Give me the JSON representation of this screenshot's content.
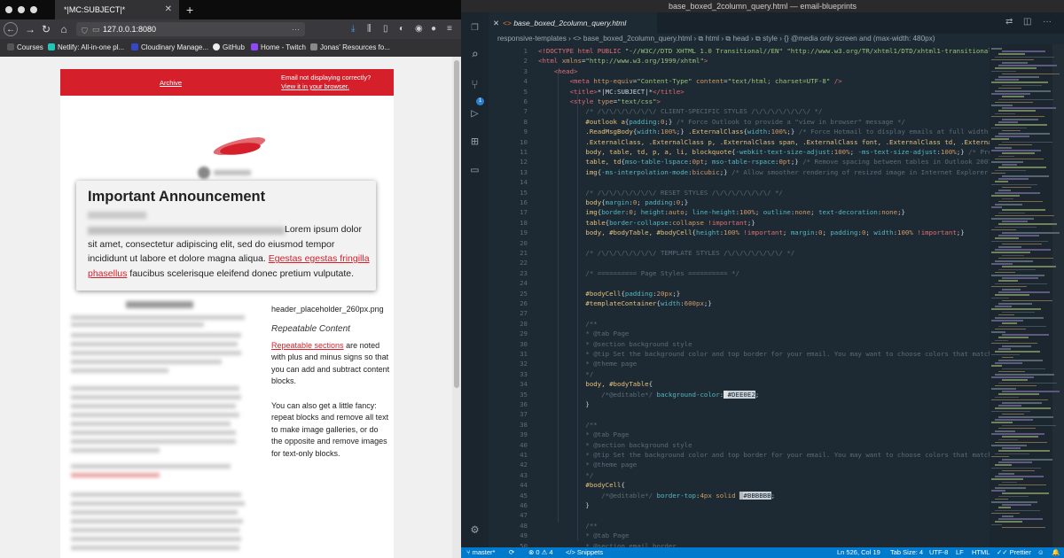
{
  "browser": {
    "tab_title": "*|MC:SUBJECT|*",
    "url": "127.0.0.1:8080",
    "bookmarks": [
      "Courses",
      "Netlify: All-in-one pl...",
      "Cloudinary Manage...",
      "GitHub",
      "Home - Twitch",
      "Jonas' Resources fo..."
    ],
    "email": {
      "archive": "Archive",
      "not_displaying": "Email not displaying correctly?",
      "view_in_browser": "View it in your browser.",
      "announcement_title": "Important Announcement",
      "announcement_text": "Lorem ipsum dolor sit amet, consectetur adipiscing elit, sed do eiusmod tempor incididunt ut labore et dolore magna aliqua.",
      "announcement_link": "Egestas egestas fringilla phasellus",
      "announcement_tail": "faucibus scelerisque eleifend donec pretium vulputate.",
      "column_title": "Number Article",
      "image_placeholder": "header_placeholder_260px.png",
      "repeatable_title": "Repeatable Content",
      "repeatable_link": "Repeatable sections",
      "repeatable_text1": "are noted with plus and minus signs so that you can add and subtract content blocks.",
      "repeatable_text2": "You can also get a little fancy: repeat blocks and remove all text to make image galleries, or do the opposite and remove images for text-only blocks."
    }
  },
  "editor": {
    "window_title": "base_boxed_2column_query.html — email-blueprints",
    "tab_label": "base_boxed_2column_query.html",
    "breadcrumbs": "responsive-templates  ›  <> base_boxed_2column_query.html  ›  ⧉ html  ›  ⧉ head  ›  ⧉ style  ›  {} @media only screen and (max-width: 480px)",
    "scm_badge": "1",
    "lines": [
      {
        "n": "1",
        "html": "<span class='k'>&lt;!DOCTYPE html PUBLIC </span><span class='s'>\"-//W3C//DTD XHTML 1.0 Transitional//EN\" \"http://www.w3.org/TR/xhtml1/DTD/xhtml1-transitional.</span>"
      },
      {
        "n": "2",
        "html": "<span class='k'>&lt;html</span> <span class='a'>xmlns</span>=<span class='s'>\"http://www.w3.org/1999/xhtml\"</span><span class='k'>&gt;</span>"
      },
      {
        "n": "3",
        "html": "    <span class='k'>&lt;head&gt;</span>"
      },
      {
        "n": "4",
        "html": "        <span class='k'>&lt;meta</span> <span class='a'>http-equiv</span>=<span class='s'>\"Content-Type\"</span> <span class='a'>content</span>=<span class='s'>\"text/html; charset=UTF-8\"</span> <span class='k'>/&gt;</span>"
      },
      {
        "n": "5",
        "html": "        <span class='k'>&lt;title&gt;</span>*|MC:SUBJECT|*<span class='k'>&lt;/title&gt;</span>"
      },
      {
        "n": "6",
        "html": "        <span class='k'>&lt;style</span> <span class='a'>type</span>=<span class='s'>\"text/css\"</span><span class='k'>&gt;</span>"
      },
      {
        "n": "7",
        "html": "            <span class='c'>/* /\\/\\/\\/\\/\\/\\/\\/ CLIENT-SPECIFIC STYLES /\\/\\/\\/\\/\\/\\/\\/ */</span>"
      },
      {
        "n": "8",
        "html": "            <span class='t'>#outlook a</span>{<span class='g'>padding</span>:<span class='a'>0</span>;} <span class='c'>/* Force Outlook to provide a \"view in browser\" message */</span>"
      },
      {
        "n": "9",
        "html": "            <span class='t'>.ReadMsgBody</span>{<span class='g'>width</span>:<span class='a'>100%</span>;} <span class='t'>.ExternalClass</span>{<span class='g'>width</span>:<span class='a'>100%</span>;} <span class='c'>/* Force Hotmail to display emails at full width */</span>"
      },
      {
        "n": "10",
        "html": "            <span class='t'>.ExternalClass, .ExternalClass p, .ExternalClass span, .ExternalClass font, .ExternalClass td, .ExternalC</span>"
      },
      {
        "n": "11",
        "html": "            <span class='t'>body, table, td, p, a, li, blockquote</span>{<span class='g'>-webkit-text-size-adjust</span>:<span class='a'>100%</span>; <span class='g'>-ms-text-size-adjust</span>:<span class='a'>100%</span>;} <span class='c'>/* Prev</span>"
      },
      {
        "n": "12",
        "html": "            <span class='t'>table, td</span>{<span class='g'>mso-table-lspace</span>:<span class='a'>0pt</span>; <span class='g'>mso-table-rspace</span>:<span class='a'>0pt</span>;} <span class='c'>/* Remove spacing between tables in Outlook 2007</span>"
      },
      {
        "n": "13",
        "html": "            <span class='t'>img</span>{<span class='g'>-ms-interpolation-mode</span>:<span class='a'>bicubic</span>;} <span class='c'>/* Allow smoother rendering of resized image in Internet Explorer */</span>"
      },
      {
        "n": "14",
        "html": ""
      },
      {
        "n": "15",
        "html": "            <span class='c'>/* /\\/\\/\\/\\/\\/\\/\\/ RESET STYLES /\\/\\/\\/\\/\\/\\/\\/ */</span>"
      },
      {
        "n": "16",
        "html": "            <span class='t'>body</span>{<span class='g'>margin</span>:<span class='a'>0</span>; <span class='g'>padding</span>:<span class='a'>0</span>;}"
      },
      {
        "n": "17",
        "html": "            <span class='t'>img</span>{<span class='g'>border</span>:<span class='a'>0</span>; <span class='g'>height</span>:<span class='a'>auto</span>; <span class='g'>line-height</span>:<span class='a'>100%</span>; <span class='g'>outline</span>:<span class='a'>none</span>; <span class='g'>text-decoration</span>:<span class='a'>none</span>;}"
      },
      {
        "n": "18",
        "html": "            <span class='t'>table</span>{<span class='g'>border-collapse</span>:<span class='a'>collapse</span> <span class='k'>!important</span>;}"
      },
      {
        "n": "19",
        "html": "            <span class='t'>body, #bodyTable, #bodyCell</span>{<span class='g'>height</span>:<span class='a'>100%</span> <span class='k'>!important</span>; <span class='g'>margin</span>:<span class='a'>0</span>; <span class='g'>padding</span>:<span class='a'>0</span>; <span class='g'>width</span>:<span class='a'>100%</span> <span class='k'>!important</span>;}"
      },
      {
        "n": "20",
        "html": ""
      },
      {
        "n": "21",
        "html": "            <span class='c'>/* /\\/\\/\\/\\/\\/\\/\\/ TEMPLATE STYLES /\\/\\/\\/\\/\\/\\/\\/ */</span>"
      },
      {
        "n": "22",
        "html": ""
      },
      {
        "n": "23",
        "html": "            <span class='c'>/* ========== Page Styles ========== */</span>"
      },
      {
        "n": "24",
        "html": ""
      },
      {
        "n": "25",
        "html": "            <span class='t'>#bodyCell</span>{<span class='g'>padding</span>:<span class='a'>20px</span>;}"
      },
      {
        "n": "26",
        "html": "            <span class='t'>#templateContainer</span>{<span class='g'>width</span>:<span class='a'>600px</span>;}"
      },
      {
        "n": "27",
        "html": ""
      },
      {
        "n": "28",
        "html": "            <span class='c'>/**</span>"
      },
      {
        "n": "29",
        "html": "            <span class='c'>* @tab Page</span>"
      },
      {
        "n": "30",
        "html": "            <span class='c'>* @section background style</span>"
      },
      {
        "n": "31",
        "html": "            <span class='c'>* @tip Set the background color and top border for your email. You may want to choose colors that match</span>"
      },
      {
        "n": "32",
        "html": "            <span class='c'>* @theme page</span>"
      },
      {
        "n": "33",
        "html": "            <span class='c'>*/</span>"
      },
      {
        "n": "34",
        "html": "            <span class='t'>body, #bodyTable</span>{"
      },
      {
        "n": "35",
        "html": "                <span class='c'>/*@editable*/</span> <span class='g'>background-color</span>:<span style='background:#DEE0E2;color:#DEE0E2'>█</span><span style='background:#c9d1d9;color:#1e2a33'>#DEE0E2</span>;"
      },
      {
        "n": "36",
        "html": "            }"
      },
      {
        "n": "37",
        "html": ""
      },
      {
        "n": "38",
        "html": "            <span class='c'>/**</span>"
      },
      {
        "n": "39",
        "html": "            <span class='c'>* @tab Page</span>"
      },
      {
        "n": "40",
        "html": "            <span class='c'>* @section background style</span>"
      },
      {
        "n": "41",
        "html": "            <span class='c'>* @tip Set the background color and top border for your email. You may want to choose colors that match</span>"
      },
      {
        "n": "42",
        "html": "            <span class='c'>* @theme page</span>"
      },
      {
        "n": "43",
        "html": "            <span class='c'>*/</span>"
      },
      {
        "n": "44",
        "html": "            <span class='t'>#bodyCell</span>{"
      },
      {
        "n": "45",
        "html": "                <span class='c'>/*@editable*/</span> <span class='g'>border-top</span>:<span class='a'>4px solid</span> <span style='background:#BBBBBB;color:#BBBBBB'>█</span><span style='background:#c9d1d9;color:#1e2a33'>#BBBBBB</span>;"
      },
      {
        "n": "46",
        "html": "            }"
      },
      {
        "n": "47",
        "html": ""
      },
      {
        "n": "48",
        "html": "            <span class='c'>/**</span>"
      },
      {
        "n": "49",
        "html": "            <span class='c'>* @tab Page</span>"
      },
      {
        "n": "50",
        "html": "            <span class='c'>* @section email border</span>"
      }
    ],
    "status": {
      "branch": "master*",
      "sync": "⟳",
      "problems": "⊗ 0  ⚠ 4",
      "snippets": "</> Snippets",
      "position": "Ln 526, Col 19",
      "tab_size": "Tab Size: 4",
      "encoding": "UTF-8",
      "eol": "LF",
      "language": "HTML",
      "formatter": "Prettier"
    }
  }
}
